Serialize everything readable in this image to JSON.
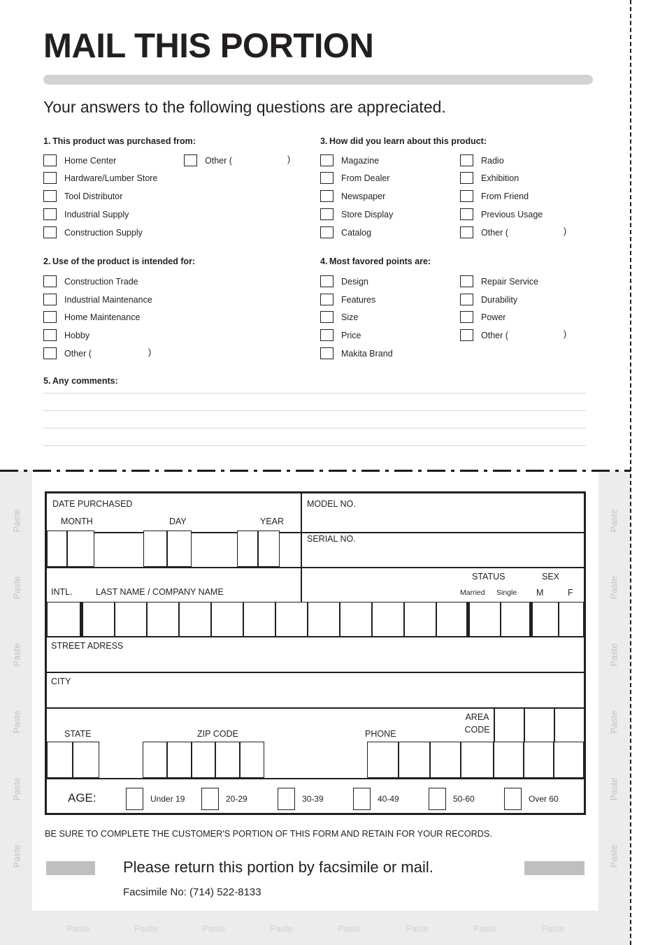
{
  "header": {
    "title": "MAIL THIS PORTION",
    "subtitle": "Your answers to the following questions are appreciated."
  },
  "questions": [
    {
      "number": "1.",
      "heading": "This product was purchased from:",
      "col1": [
        "Home Center",
        "Hardware/Lumber Store",
        "Tool Distributor",
        "Industrial Supply",
        "Construction Supply"
      ],
      "col2": [
        "Other ("
      ],
      "col2_close": [
        ")"
      ]
    },
    {
      "number": "2.",
      "heading": "Use of the product is intended for:",
      "col1": [
        "Construction Trade",
        "Industrial Maintenance",
        "Home Maintenance",
        "Hobby",
        "Other ("
      ],
      "col1_close_index": 4,
      "col1_close": ")"
    },
    {
      "number": "3.",
      "heading": "How did you learn about this product:",
      "col1": [
        "Magazine",
        "From Dealer",
        "Newspaper",
        "Store Display",
        "Catalog"
      ],
      "col2": [
        "Radio",
        "Exhibition",
        "From Friend",
        "Previous Usage",
        "Other ("
      ],
      "col2_close_index": 4,
      "col2_close": ")"
    },
    {
      "number": "4.",
      "heading": "Most favored points are:",
      "col1": [
        "Design",
        "Features",
        "Size",
        "Price",
        "Makita Brand"
      ],
      "col2": [
        "Repair Service",
        "Durability",
        "Power",
        "Other ("
      ],
      "col2_close_index": 3,
      "col2_close": ")"
    },
    {
      "number": "5.",
      "heading": "Any comments:"
    }
  ],
  "form": {
    "date_purchased": "DATE PURCHASED",
    "month": "MONTH",
    "day": "DAY",
    "year": "YEAR",
    "model_no": "MODEL NO.",
    "serial_no": "SERIAL NO.",
    "intl": "INTL.",
    "last_name": "LAST NAME / COMPANY NAME",
    "status": "STATUS",
    "married": "Married",
    "single": "Single",
    "sex": "SEX",
    "male": "M",
    "female": "F",
    "street_address": "STREET ADRESS",
    "city": "CITY",
    "state": "STATE",
    "zip_code": "ZIP CODE",
    "phone": "PHONE",
    "area": "AREA",
    "code": "CODE",
    "age_label": "AGE:",
    "age_options": [
      "Under 19",
      "20-29",
      "30-39",
      "40-49",
      "50-60",
      "Over 60"
    ]
  },
  "footer": {
    "notice": "BE SURE TO COMPLETE THE CUSTOMER'S PORTION OF THIS FORM AND RETAIN FOR YOUR RECORDS.",
    "return_line": "Please return this portion by facsimile or mail.",
    "fax_line": "Facsimile No: (714) 522-8133"
  },
  "paste": {
    "label": "Paste",
    "left_count": 6,
    "right_count": 6,
    "bottom_count": 8
  },
  "colors": {
    "ink": "#231f20",
    "headbar": "#d3d3d3",
    "grey_block": "#bfbfbf",
    "paste_bg": "#ececec",
    "paste_text": "#c2c2c2",
    "rule": "#d8d8d8"
  }
}
